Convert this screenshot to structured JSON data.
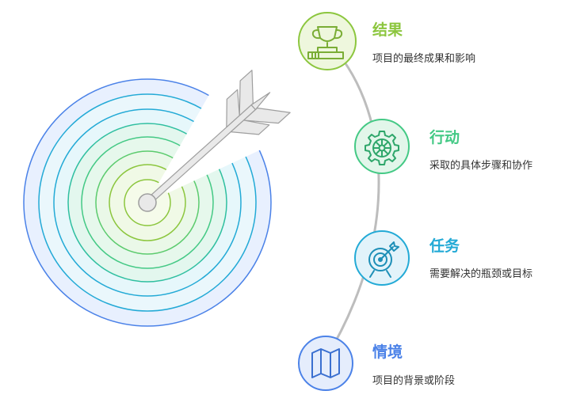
{
  "colors": {
    "result": "#8cc63e",
    "action": "#44c985",
    "task": "#23aad6",
    "situation": "#4b82e8",
    "connector": "#bdbdbd",
    "arrow": "#e9e9e9",
    "arrow_stroke": "#9e9e9e"
  },
  "steps": [
    {
      "key": "result",
      "title": "结果",
      "desc": "项目的最终成果和影响",
      "icon": "trophy-icon"
    },
    {
      "key": "action",
      "title": "行动",
      "desc": "采取的具体步骤和协作",
      "icon": "gear-icon"
    },
    {
      "key": "task",
      "title": "任务",
      "desc": "需要解决的瓶颈或目标",
      "icon": "target-icon"
    },
    {
      "key": "situation",
      "title": "情境",
      "desc": "项目的背景或阶段",
      "icon": "map-icon"
    }
  ]
}
